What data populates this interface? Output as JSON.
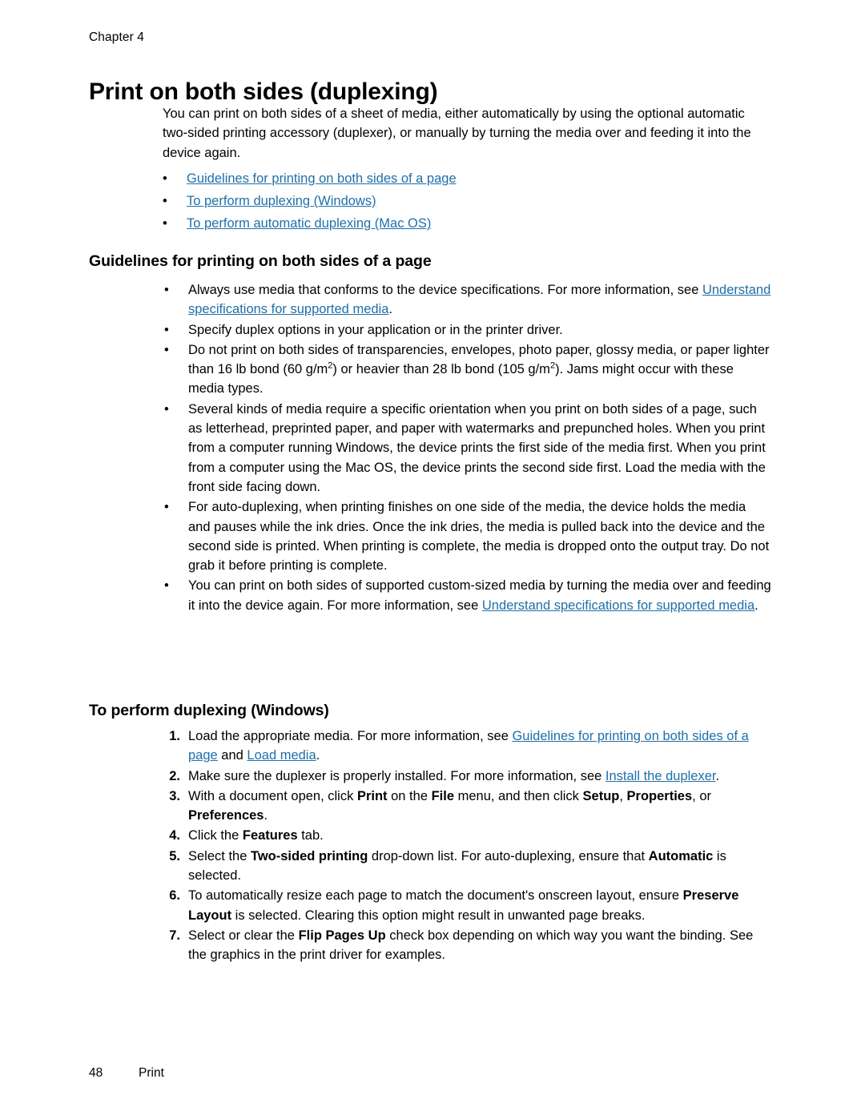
{
  "header": {
    "chapter": "Chapter 4"
  },
  "title": "Print on both sides (duplexing)",
  "intro": "You can print on both sides of a sheet of media, either automatically by using the optional automatic two-sided printing accessory (duplexer), or manually by turning the media over and feeding it into the device again.",
  "toc": {
    "bullet": "•",
    "items": [
      "Guidelines for printing on both sides of a page",
      "To perform duplexing (Windows)",
      "To perform automatic duplexing (Mac OS)"
    ]
  },
  "section1": {
    "heading": "Guidelines for printing on both sides of a page",
    "bullet": "•",
    "items": [
      {
        "pre": "Always use media that conforms to the device specifications. For more information, see ",
        "link": "Understand specifications for supported media",
        "post": "."
      },
      {
        "pre": "Specify duplex options in your application or in the printer driver.",
        "link": "",
        "post": ""
      },
      {
        "pre": "Do not print on both sides of transparencies, envelopes, photo paper, glossy media, or paper lighter than 16 lb bond (60 g/m",
        "sup1": "2",
        "mid": ") or heavier than 28 lb bond (105 g/m",
        "sup2": "2",
        "post": "). Jams might occur with these media types."
      },
      {
        "pre": "Several kinds of media require a specific orientation when you print on both sides of a page, such as letterhead, preprinted paper, and paper with watermarks and prepunched holes. When you print from a computer running Windows, the device prints the first side of the media first. When you print from a computer using the Mac OS, the device prints the second side first. Load the media with the front side facing down.",
        "link": "",
        "post": ""
      },
      {
        "pre": "For auto-duplexing, when printing finishes on one side of the media, the device holds the media and pauses while the ink dries. Once the ink dries, the media is pulled back into the device and the second side is printed. When printing is complete, the media is dropped onto the output tray. Do not grab it before printing is complete.",
        "link": "",
        "post": ""
      },
      {
        "pre": "You can print on both sides of supported custom-sized media by turning the media over and feeding it into the device again. For more information, see ",
        "link": "Understand specifications for supported media",
        "post": "."
      }
    ]
  },
  "section2": {
    "heading": "To perform duplexing (Windows)",
    "steps": [
      {
        "num": "1.",
        "p1": "Load the appropriate media. For more information, see ",
        "link1": "Guidelines for printing on both sides of a page",
        "p2": " and ",
        "link2": "Load media",
        "p3": "."
      },
      {
        "num": "2.",
        "p1": "Make sure the duplexer is properly installed. For more information, see ",
        "link1": "Install the duplexer",
        "p2": "",
        "link2": "",
        "p3": "."
      },
      {
        "num": "3.",
        "p1": "With a document open, click ",
        "b1": "Print",
        "p2": " on the ",
        "b2": "File",
        "p3": " menu, and then click ",
        "b3": "Setup",
        "p4": ", ",
        "b4": "Properties",
        "p5": ", or ",
        "b5": "Preferences",
        "p6": "."
      },
      {
        "num": "4.",
        "p1": "Click the ",
        "b1": "Features",
        "p2": " tab."
      },
      {
        "num": "5.",
        "p1": "Select the ",
        "b1": "Two-sided printing",
        "p2": " drop-down list. For auto-duplexing, ensure that ",
        "b2": "Automatic",
        "p3": " is selected."
      },
      {
        "num": "6.",
        "p1": "To automatically resize each page to match the document's onscreen layout, ensure ",
        "b1": "Preserve Layout",
        "p2": " is selected. Clearing this option might result in unwanted page breaks."
      },
      {
        "num": "7.",
        "p1": "Select or clear the ",
        "b1": "Flip Pages Up",
        "p2": " check box depending on which way you want the binding. See the graphics in the print driver for examples."
      }
    ]
  },
  "footer": {
    "page_number": "48",
    "label": "Print"
  },
  "colors": {
    "link": "#1F6FA8",
    "text": "#000000",
    "background": "#FFFFFF"
  }
}
